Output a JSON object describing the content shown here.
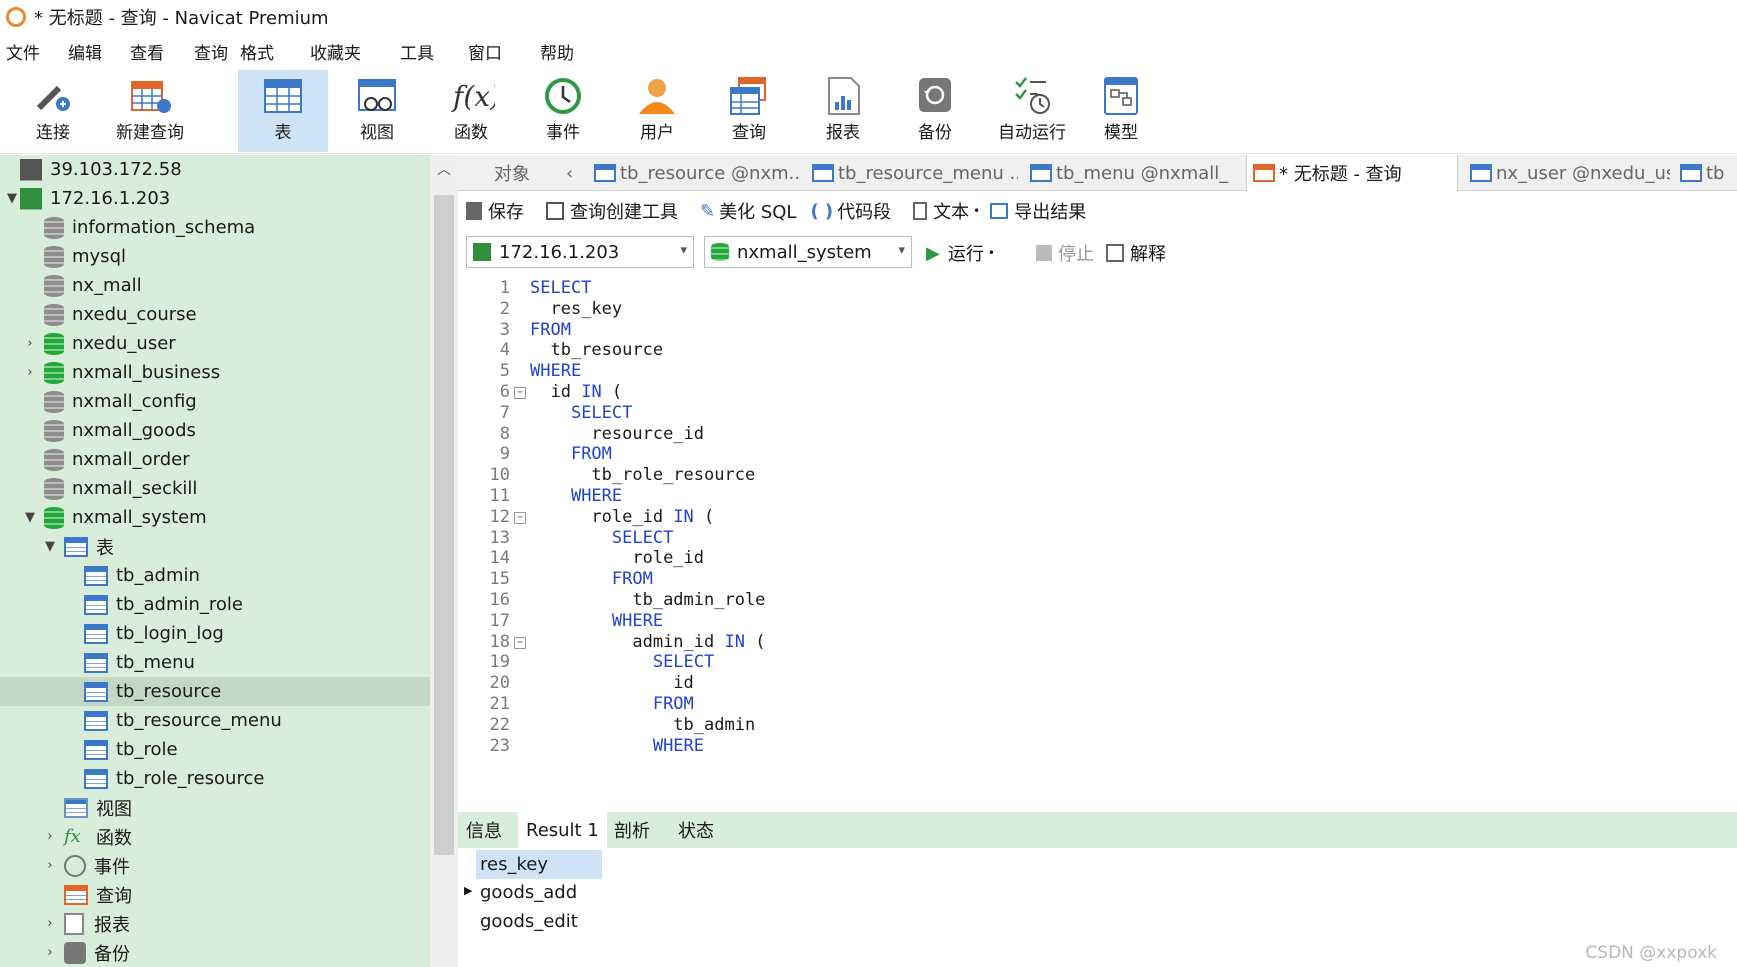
{
  "window": {
    "title": "* 无标题 - 查询 - Navicat Premium"
  },
  "menu": [
    "文件",
    "编辑",
    "查看",
    "查询",
    "格式",
    "收藏夹",
    "工具",
    "窗口",
    "帮助"
  ],
  "toolbar": {
    "buttons": [
      {
        "label": "连接",
        "icon": "connect-icon"
      },
      {
        "label": "新建查询",
        "icon": "new-query-icon"
      },
      {
        "label": "表",
        "icon": "table-icon"
      },
      {
        "label": "视图",
        "icon": "view-icon"
      },
      {
        "label": "函数",
        "icon": "function-icon"
      },
      {
        "label": "事件",
        "icon": "event-icon"
      },
      {
        "label": "用户",
        "icon": "user-icon"
      },
      {
        "label": "查询",
        "icon": "query-icon"
      },
      {
        "label": "报表",
        "icon": "report-icon"
      },
      {
        "label": "备份",
        "icon": "backup-icon"
      },
      {
        "label": "自动运行",
        "icon": "autorun-icon"
      },
      {
        "label": "模型",
        "icon": "model-icon"
      }
    ]
  },
  "sidebar": {
    "servers": [
      "39.103.172.58",
      "172.16.1.203"
    ],
    "databases": [
      "information_schema",
      "mysql",
      "nx_mall",
      "nxedu_course",
      "nxedu_user",
      "nxmall_business",
      "nxmall_config",
      "nxmall_goods",
      "nxmall_order",
      "nxmall_seckill",
      "nxmall_system"
    ],
    "tables_label": "表",
    "tables": [
      "tb_admin",
      "tb_admin_role",
      "tb_login_log",
      "tb_menu",
      "tb_resource",
      "tb_resource_menu",
      "tb_role",
      "tb_role_resource"
    ],
    "groups": [
      "视图",
      "函数",
      "事件",
      "查询",
      "报表",
      "备份"
    ]
  },
  "tabs": {
    "objects": "对象",
    "items": [
      "tb_resource @nxm...",
      "tb_resource_menu ...",
      "tb_menu @nxmall_...",
      "* 无标题 - 查询",
      "nx_user @nxedu_us...",
      "tb"
    ]
  },
  "query_toolbar": {
    "save": "保存",
    "builder": "查询创建工具",
    "beautify": "美化 SQL",
    "snippet": "代码段",
    "text": "文本",
    "export": "导出结果"
  },
  "query_selectors": {
    "connection": "172.16.1.203",
    "database": "nxmall_system",
    "run": "运行",
    "stop": "停止",
    "explain": "解释"
  },
  "editor": {
    "lines": [
      {
        "n": "1",
        "indent": "",
        "kw": "SELECT",
        "text": ""
      },
      {
        "n": "2",
        "indent": "  ",
        "kw": "",
        "text": "res_key"
      },
      {
        "n": "3",
        "indent": "",
        "kw": "FROM",
        "text": ""
      },
      {
        "n": "4",
        "indent": "  ",
        "kw": "",
        "text": "tb_resource"
      },
      {
        "n": "5",
        "indent": "",
        "kw": "WHERE",
        "text": ""
      },
      {
        "n": "6",
        "indent": "  ",
        "kw": "",
        "text": "id IN (",
        "fold": true
      },
      {
        "n": "7",
        "indent": "    ",
        "kw": "SELECT",
        "text": ""
      },
      {
        "n": "8",
        "indent": "      ",
        "kw": "",
        "text": "resource_id"
      },
      {
        "n": "9",
        "indent": "    ",
        "kw": "FROM",
        "text": ""
      },
      {
        "n": "10",
        "indent": "      ",
        "kw": "",
        "text": "tb_role_resource"
      },
      {
        "n": "11",
        "indent": "    ",
        "kw": "WHERE",
        "text": ""
      },
      {
        "n": "12",
        "indent": "      ",
        "kw": "",
        "text": "role_id IN (",
        "fold": true
      },
      {
        "n": "13",
        "indent": "        ",
        "kw": "SELECT",
        "text": ""
      },
      {
        "n": "14",
        "indent": "          ",
        "kw": "",
        "text": "role_id"
      },
      {
        "n": "15",
        "indent": "        ",
        "kw": "FROM",
        "text": ""
      },
      {
        "n": "16",
        "indent": "          ",
        "kw": "",
        "text": "tb_admin_role"
      },
      {
        "n": "17",
        "indent": "        ",
        "kw": "WHERE",
        "text": ""
      },
      {
        "n": "18",
        "indent": "          ",
        "kw": "",
        "text": "admin_id IN (",
        "fold": true
      },
      {
        "n": "19",
        "indent": "            ",
        "kw": "SELECT",
        "text": ""
      },
      {
        "n": "20",
        "indent": "              ",
        "kw": "",
        "text": "id"
      },
      {
        "n": "21",
        "indent": "            ",
        "kw": "FROM",
        "text": ""
      },
      {
        "n": "22",
        "indent": "              ",
        "kw": "",
        "text": "tb_admin"
      },
      {
        "n": "23",
        "indent": "            ",
        "kw": "WHERE",
        "text": ""
      }
    ]
  },
  "result_tabs": [
    "信息",
    "Result 1",
    "剖析",
    "状态"
  ],
  "results": {
    "column": "res_key",
    "rows": [
      "goods_add",
      "goods_edit"
    ]
  },
  "watermark": "CSDN @xxpoxk",
  "colors": {
    "sidebar_bg": "#d8eeda",
    "keyword": "#2244cc",
    "selected_tab": "#cfe3f6"
  }
}
